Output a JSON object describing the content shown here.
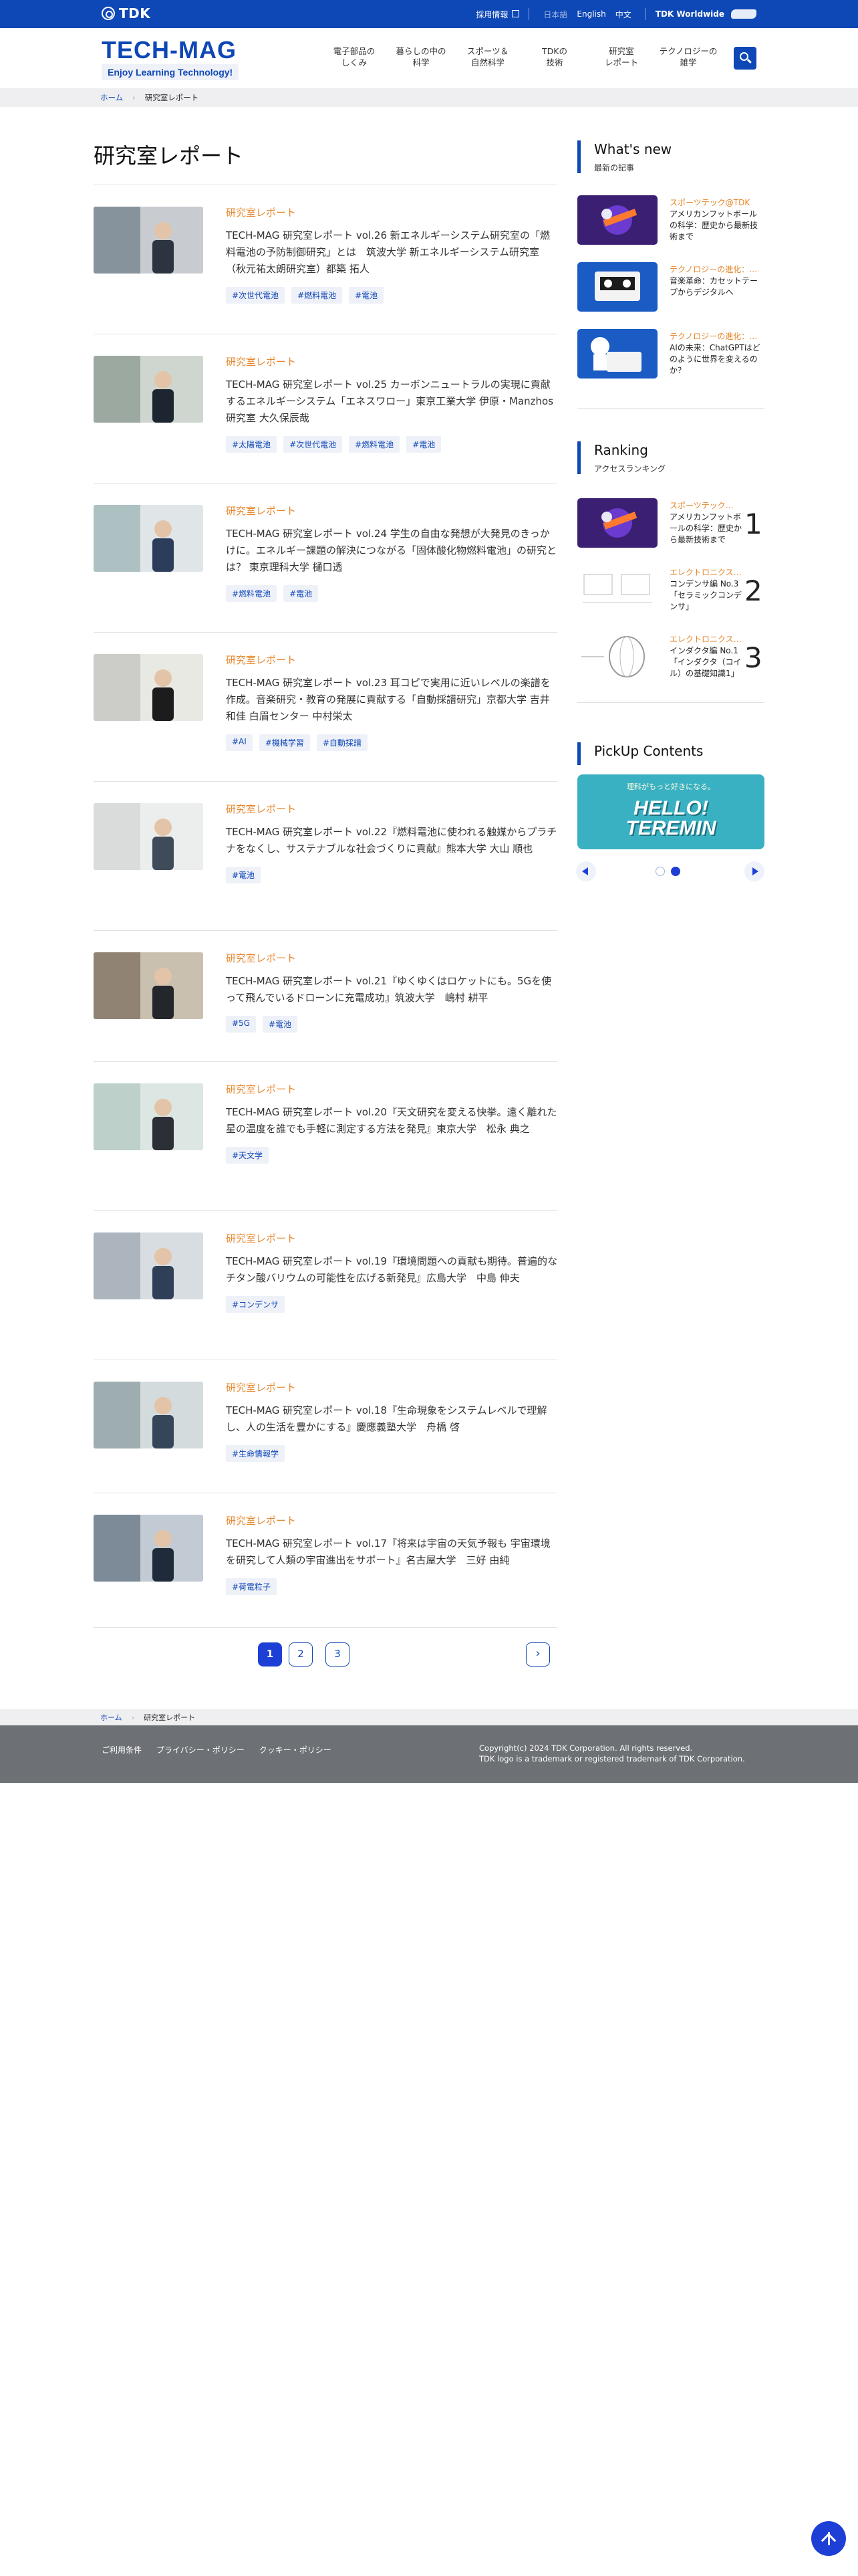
{
  "topbar": {
    "logo": "TDK",
    "recruit": "採用情報",
    "languages": [
      "日本語",
      "English",
      "中文"
    ],
    "worldwide": "TDK Worldwide"
  },
  "header": {
    "brand": "TECH-MAG",
    "tagline": "Enjoy Learning Technology!",
    "nav": [
      "電子部品の\nしくみ",
      "暮らしの中の\n科学",
      "スポーツ＆\n自然科学",
      "TDKの\n技術",
      "研究室\nレポート",
      "テクノロジーの\n雑学"
    ]
  },
  "breadcrumb": {
    "home": "ホーム",
    "current": "研究室レポート"
  },
  "page_title": "研究室レポート",
  "articles": [
    {
      "category": "研究室レポート",
      "title": "TECH-MAG 研究室レポート vol.26 新エネルギーシステム研究室の「燃料電池の予防制御研究」とは　筑波大学 新エネルギーシステム研究室（秋元祐太朗研究室）都築 拓人",
      "tags": [
        "#次世代電池",
        "#燃料電池",
        "#電池"
      ]
    },
    {
      "category": "研究室レポート",
      "title": "TECH-MAG 研究室レポート vol.25 カーボンニュートラルの実現に貢献するエネルギーシステム「エネスワロー」東京工業大学 伊原・Manzhos研究室 大久保辰哉",
      "tags": [
        "#太陽電池",
        "#次世代電池",
        "#燃料電池",
        "#電池"
      ]
    },
    {
      "category": "研究室レポート",
      "title": "TECH-MAG 研究室レポート vol.24 学生の自由な発想が大発見のきっかけに。エネルギー課題の解決につながる「固体酸化物燃料電池」の研究とは？ 東京理科大学 樋口透",
      "tags": [
        "#燃料電池",
        "#電池"
      ]
    },
    {
      "category": "研究室レポート",
      "title": "TECH-MAG 研究室レポート vol.23 耳コピで実用に近いレベルの楽譜を作成。音楽研究・教育の発展に貢献する「自動採譜研究」京都大学 吉井和佳 白眉センター 中村栄太",
      "tags": [
        "#AI",
        "#機械学習",
        "#自動採譜"
      ]
    },
    {
      "category": "研究室レポート",
      "title": "TECH-MAG 研究室レポート vol.22『燃料電池に使われる触媒からプラチナをなくし、サステナブルな社会づくりに貢献』熊本大学 大山 順也",
      "tags": [
        "#電池"
      ]
    },
    {
      "category": "研究室レポート",
      "title": "TECH-MAG 研究室レポート vol.21『ゆくゆくはロケットにも。5Gを使って飛んでいるドローンに充電成功』筑波大学　嶋村 耕平",
      "tags": [
        "#5G",
        "#電池"
      ]
    },
    {
      "category": "研究室レポート",
      "title": "TECH-MAG 研究室レポート vol.20『天文研究を変える快挙。遠く離れた星の温度を誰でも手軽に測定する方法を発見』東京大学　松永 典之",
      "tags": [
        "#天文学"
      ]
    },
    {
      "category": "研究室レポート",
      "title": "TECH-MAG 研究室レポート vol.19『環境問題への貢献も期待。普遍的なチタン酸バリウムの可能性を広げる新発見』広島大学　中島 伸夫",
      "tags": [
        "#コンデンサ"
      ]
    },
    {
      "category": "研究室レポート",
      "title": "TECH-MAG 研究室レポート vol.18『生命現象をシステムレベルで理解し、人の生活を豊かにする』慶應義塾大学　舟橋 啓",
      "tags": [
        "#生命情報学"
      ]
    },
    {
      "category": "研究室レポート",
      "title": "TECH-MAG 研究室レポート vol.17『将来は宇宙の天気予報も 宇宙環境を研究して人類の宇宙進出をサポート』名古屋大学　三好 由純",
      "tags": [
        "#荷電粒子"
      ]
    }
  ],
  "pagination": {
    "pages": [
      "1",
      "2",
      "3"
    ],
    "current": 1,
    "next": "›"
  },
  "sidebar": {
    "whats_new": {
      "title": "What's new",
      "subtitle": "最新の記事",
      "items": [
        {
          "category": "スポーツテック@TDK",
          "title": "アメリカンフットボールの科学：歴史から最新技術まで"
        },
        {
          "category": "テクノロジーの進化：…",
          "title": "音楽革命：カセットテープからデジタルへ"
        },
        {
          "category": "テクノロジーの進化：…",
          "title": "AIの未来：ChatGPTはどのように世界を変えるのか？"
        }
      ]
    },
    "ranking": {
      "title": "Ranking",
      "subtitle": "アクセスランキング",
      "items": [
        {
          "rank": "1",
          "category": "スポーツテック…",
          "title": "アメリカンフットボールの科学：歴史から最新技術まで"
        },
        {
          "rank": "2",
          "category": "エレクトロニクス…",
          "title": "コンデンサ編 No.3「セラミックコンデンサ」"
        },
        {
          "rank": "3",
          "category": "エレクトロニクス…",
          "title": "インダクタ編 No.1「インダクタ（コイル）の基礎知識1」"
        }
      ]
    },
    "pickup": {
      "title": "PickUp Contents",
      "banner_small": "理科がもっと好きになる。",
      "banner_big": "HELLO! TEREMIN"
    }
  },
  "footer": {
    "links": [
      "ご利用条件",
      "プライバシー・ポリシー",
      "クッキー・ポリシー"
    ],
    "copyright": "Copyright(c) 2024 TDK Corporation. All rights reserved.",
    "trademark": "TDK logo is a trademark or registered trademark of TDK Corporation."
  },
  "colors": {
    "brand": "#0e47b6",
    "accent": "#e6852a",
    "active": "#1e3fd6"
  }
}
